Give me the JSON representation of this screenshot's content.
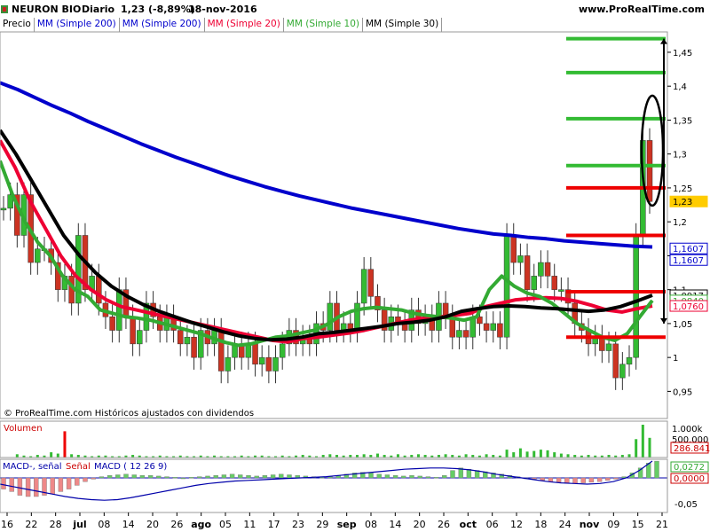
{
  "header": {
    "symbol": "NEURON BIO",
    "period": "Diario",
    "last_quote": "1,23 (-8,89%)",
    "date": "18-nov-2016",
    "site": "www.ProRealTime.com"
  },
  "legend": [
    {
      "label": "Precio",
      "color": "#000000"
    },
    {
      "label": "MM (Simple 200)",
      "color": "#0000cc"
    },
    {
      "label": "MM (Simple 200)",
      "color": "#0000cc"
    },
    {
      "label": "MM (Simple 20)",
      "color": "#ee0033"
    },
    {
      "label": "MM (Simple 10)",
      "color": "#33aa33"
    },
    {
      "label": "MM (Simple 30)",
      "color": "#000000"
    }
  ],
  "credit": "© ProRealTime.com Históricos ajustados con dividendos",
  "volume_panel": {
    "label": "Volumen",
    "axis_labels": [
      "1.000k",
      "500.000"
    ],
    "last_value": "286.841"
  },
  "macd_panel": {
    "labels": [
      "MACD-, señal",
      "Señal",
      "MACD ( 12 26 9)"
    ],
    "axis_labels": [
      "-0,05"
    ],
    "value_macd": "0,0272",
    "value_signal": "0,0000"
  },
  "chart_data": {
    "type": "line",
    "title": "NEURON BIO",
    "ylim": [
      0.91,
      1.48
    ],
    "price_axis_ticks": [
      "1,45",
      "1,4",
      "1,35",
      "1,3",
      "1,25",
      "1,2",
      "1,15",
      "1,1",
      "1,05",
      "1",
      "0,95"
    ],
    "price_axis_values": [
      1.45,
      1.4,
      1.35,
      1.3,
      1.25,
      1.2,
      1.15,
      1.1,
      1.05,
      1.0,
      0.95
    ],
    "x_ticks": [
      "16",
      "22",
      "28",
      "jul",
      "08",
      "14",
      "20",
      "26",
      "ago",
      "05",
      "11",
      "17",
      "23",
      "29",
      "sep",
      "08",
      "14",
      "20",
      "26",
      "oct",
      "06",
      "12",
      "18",
      "24",
      "nov",
      "09",
      "15",
      "21"
    ],
    "value_tags": [
      {
        "value": 1.23,
        "text": "1,23",
        "color": "#ffcc00",
        "text_color": "#000000"
      },
      {
        "value": 1.1607,
        "text": "1,1607",
        "color": "#0000cc",
        "text_color": "#0000cc"
      },
      {
        "value": 1.1607,
        "text": "1,1607",
        "color": "#0000cc",
        "text_color": "#0000cc"
      },
      {
        "value": 1.0917,
        "text": "1,0917",
        "color": "#000000",
        "text_color": "#000000"
      },
      {
        "value": 1.084,
        "text": "1,0840",
        "color": "#33aa33",
        "text_color": "#33aa33"
      },
      {
        "value": 1.076,
        "text": "1,0760",
        "color": "#ee0033",
        "text_color": "#ee0033"
      }
    ],
    "horizontal_levels": [
      {
        "value": 1.47,
        "color": "#33bb33"
      },
      {
        "value": 1.42,
        "color": "#33bb33"
      },
      {
        "value": 1.352,
        "color": "#33bb33"
      },
      {
        "value": 1.283,
        "color": "#33bb33"
      },
      {
        "value": 1.25,
        "color": "#ee0000"
      },
      {
        "value": 1.18,
        "color": "#ee0000"
      },
      {
        "value": 1.097,
        "color": "#ee0000"
      },
      {
        "value": 1.03,
        "color": "#ee0000"
      }
    ],
    "candles": [
      1.22,
      1.24,
      1.18,
      1.24,
      1.14,
      1.16,
      1.16,
      1.14,
      1.1,
      1.12,
      1.08,
      1.18,
      1.1,
      1.12,
      1.08,
      1.06,
      1.04,
      1.1,
      1.06,
      1.02,
      1.04,
      1.08,
      1.06,
      1.04,
      1.06,
      1.04,
      1.02,
      1.03,
      1.0,
      1.04,
      1.02,
      1.04,
      0.98,
      1.0,
      1.02,
      1.0,
      1.02,
      0.99,
      1.0,
      0.98,
      1.0,
      1.02,
      1.04,
      1.02,
      1.03,
      1.02,
      1.05,
      1.04,
      1.08,
      1.04,
      1.05,
      1.04,
      1.08,
      1.13,
      1.09,
      1.07,
      1.04,
      1.06,
      1.05,
      1.04,
      1.07,
      1.05,
      1.06,
      1.04,
      1.08,
      1.06,
      1.03,
      1.04,
      1.03,
      1.06,
      1.05,
      1.04,
      1.05,
      1.03,
      1.18,
      1.14,
      1.15,
      1.1,
      1.12,
      1.14,
      1.12,
      1.1,
      1.1,
      1.08,
      1.05,
      1.04,
      1.02,
      1.03,
      1.01,
      1.02,
      0.97,
      0.99,
      1.0,
      1.18,
      1.32,
      1.23
    ],
    "series": [
      {
        "name": "MM (Simple 200)",
        "color": "#0000cc",
        "values": [
          1.405,
          1.395,
          1.383,
          1.371,
          1.36,
          1.348,
          1.337,
          1.326,
          1.315,
          1.305,
          1.295,
          1.286,
          1.277,
          1.268,
          1.26,
          1.252,
          1.245,
          1.238,
          1.232,
          1.226,
          1.22,
          1.215,
          1.21,
          1.205,
          1.2,
          1.195,
          1.19,
          1.186,
          1.182,
          1.18,
          1.177,
          1.175,
          1.172,
          1.17,
          1.168,
          1.166,
          1.164,
          1.163
        ]
      },
      {
        "name": "MM (Simple 20)",
        "color": "#ee0033",
        "values": [
          1.32,
          1.28,
          1.23,
          1.19,
          1.15,
          1.12,
          1.1,
          1.085,
          1.075,
          1.07,
          1.065,
          1.06,
          1.055,
          1.05,
          1.045,
          1.04,
          1.035,
          1.03,
          1.025,
          1.023,
          1.028,
          1.03,
          1.033,
          1.036,
          1.04,
          1.045,
          1.05,
          1.055,
          1.058,
          1.06,
          1.062,
          1.065,
          1.075,
          1.08,
          1.085,
          1.087,
          1.088,
          1.087,
          1.083,
          1.077,
          1.07,
          1.067,
          1.072,
          1.076
        ]
      },
      {
        "name": "MM (Simple 10)",
        "color": "#33aa33",
        "values": [
          1.29,
          1.24,
          1.2,
          1.17,
          1.15,
          1.12,
          1.1,
          1.09,
          1.07,
          1.065,
          1.06,
          1.058,
          1.055,
          1.05,
          1.045,
          1.04,
          1.035,
          1.028,
          1.022,
          1.018,
          1.02,
          1.025,
          1.03,
          1.032,
          1.036,
          1.04,
          1.048,
          1.06,
          1.068,
          1.072,
          1.074,
          1.072,
          1.07,
          1.065,
          1.062,
          1.06,
          1.058,
          1.055,
          1.06,
          1.1,
          1.12,
          1.105,
          1.095,
          1.09,
          1.08,
          1.065,
          1.05,
          1.04,
          1.03,
          1.025,
          1.035,
          1.06,
          1.084
        ]
      },
      {
        "name": "MM (Simple 30)",
        "color": "#000000",
        "values": [
          1.335,
          1.3,
          1.26,
          1.22,
          1.18,
          1.15,
          1.125,
          1.105,
          1.09,
          1.078,
          1.068,
          1.06,
          1.052,
          1.045,
          1.038,
          1.032,
          1.028,
          1.026,
          1.027,
          1.03,
          1.035,
          1.037,
          1.04,
          1.043,
          1.046,
          1.05,
          1.052,
          1.055,
          1.06,
          1.068,
          1.072,
          1.075,
          1.076,
          1.075,
          1.073,
          1.072,
          1.07,
          1.068,
          1.07,
          1.075,
          1.083,
          1.0917
        ]
      }
    ],
    "volume": [
      0,
      0,
      5,
      3,
      2,
      4,
      3,
      8,
      6,
      40,
      5,
      4,
      3,
      2,
      3,
      3,
      2,
      2,
      3,
      4,
      3,
      2,
      2,
      3,
      2,
      2,
      3,
      2,
      2,
      3,
      2,
      3,
      2,
      2,
      2,
      3,
      2,
      3,
      3,
      2,
      2,
      3,
      2,
      3,
      4,
      3,
      2,
      4,
      5,
      4,
      3,
      4,
      4,
      5,
      4,
      6,
      4,
      3,
      5,
      3,
      4,
      5,
      4,
      3,
      4,
      5,
      4,
      3,
      5,
      4,
      3,
      5,
      4,
      3,
      12,
      8,
      14,
      9,
      10,
      12,
      11,
      8,
      6,
      5,
      4,
      3,
      4,
      3,
      3,
      4,
      3,
      4,
      5,
      28,
      50,
      30
    ],
    "macd_hist": [
      -0.018,
      -0.022,
      -0.028,
      -0.03,
      -0.03,
      -0.028,
      -0.026,
      -0.022,
      -0.018,
      -0.012,
      -0.006,
      -0.002,
      0.002,
      0.004,
      0.005,
      0.006,
      0.005,
      0.004,
      0.004,
      0.003,
      0.002,
      0.001,
      0.0,
      0.001,
      0.002,
      0.003,
      0.004,
      0.005,
      0.006,
      0.005,
      0.004,
      0.003,
      0.004,
      0.005,
      0.006,
      0.005,
      0.004,
      0.003,
      0.002,
      0.001,
      0.002,
      0.004,
      0.006,
      0.008,
      0.009,
      0.008,
      0.006,
      0.005,
      0.004,
      0.003,
      0.004,
      0.003,
      0.002,
      0.001,
      0.004,
      0.012,
      0.016,
      0.014,
      0.012,
      0.01,
      0.008,
      0.006,
      0.004,
      0.002,
      0.0,
      -0.002,
      -0.004,
      -0.006,
      -0.007,
      -0.008,
      -0.009,
      -0.008,
      -0.007,
      -0.006,
      -0.004,
      -0.002,
      0.002,
      0.008,
      0.016,
      0.024,
      0.027
    ],
    "macd_line": [
      -0.01,
      -0.014,
      -0.018,
      -0.022,
      -0.026,
      -0.03,
      -0.033,
      -0.035,
      -0.036,
      -0.035,
      -0.032,
      -0.028,
      -0.024,
      -0.02,
      -0.016,
      -0.012,
      -0.009,
      -0.007,
      -0.005,
      -0.004,
      -0.003,
      -0.002,
      -0.001,
      0.0,
      0.001,
      0.002,
      0.004,
      0.006,
      0.008,
      0.01,
      0.012,
      0.014,
      0.015,
      0.016,
      0.016,
      0.015,
      0.013,
      0.01,
      0.006,
      0.003,
      0.0,
      -0.003,
      -0.006,
      -0.008,
      -0.009,
      -0.01,
      -0.009,
      -0.006,
      0.0,
      0.012,
      0.0272
    ]
  }
}
